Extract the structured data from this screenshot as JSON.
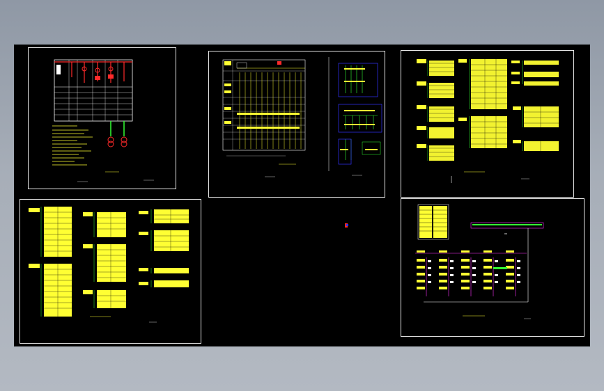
{
  "window": {
    "title": ""
  },
  "colors": {
    "background_top": "#8f98a5",
    "canvas": "#000000",
    "frame": "#e8e8e8",
    "yellow": "#ffff33",
    "green": "#33ff33",
    "red": "#ff2a2a",
    "magenta": "#ff33ff",
    "blue": "#3333ff",
    "white": "#ffffff"
  },
  "sheets": [
    {
      "id": "sheet-1",
      "caption": "",
      "note": ""
    },
    {
      "id": "sheet-2",
      "caption": "",
      "note": ""
    },
    {
      "id": "sheet-3",
      "caption": "",
      "note": ""
    },
    {
      "id": "sheet-4",
      "caption": "",
      "note": ""
    },
    {
      "id": "sheet-5",
      "caption": "",
      "note": ""
    }
  ],
  "icons": [
    "origin-marker-icon"
  ]
}
